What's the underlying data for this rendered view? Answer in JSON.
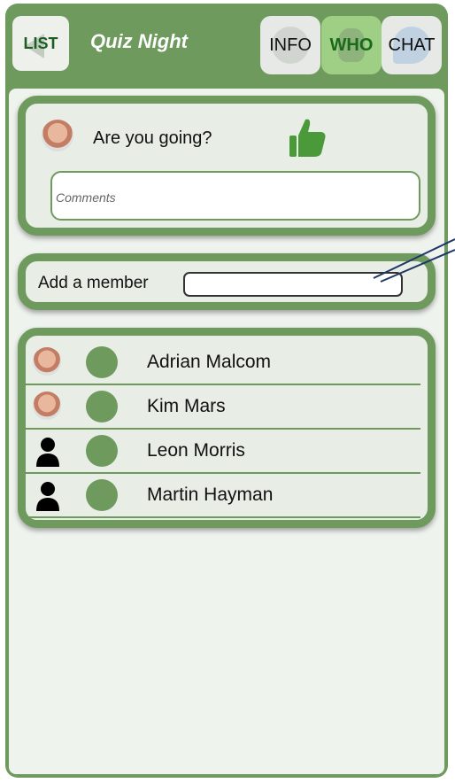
{
  "header": {
    "list_label": "LIST",
    "title": "Quiz Night",
    "tabs": [
      {
        "label": "INFO",
        "icon": "info-icon"
      },
      {
        "label": "WHO",
        "icon": "person-icon",
        "active": true
      },
      {
        "label": "CHAT",
        "icon": "chat-bubble-icon"
      }
    ]
  },
  "going": {
    "question": "Are you going?",
    "status_icon": "thumbs-up-icon",
    "comments_placeholder": "Comments"
  },
  "add_member": {
    "label": "Add a member",
    "value": ""
  },
  "members": [
    {
      "name": "Adrian Malcom",
      "avatar": "photo"
    },
    {
      "name": "Kim Mars",
      "avatar": "photo"
    },
    {
      "name": "Leon Morris",
      "avatar": "silhouette"
    },
    {
      "name": "Martin Hayman",
      "avatar": "silhouette"
    }
  ],
  "colors": {
    "primary_green": "#6f9a5e",
    "active_tab": "#9fcf84",
    "panel_bg": "#eff3ee"
  }
}
